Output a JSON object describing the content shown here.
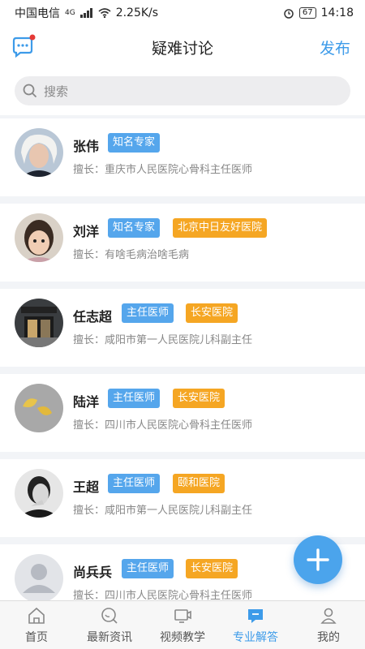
{
  "status": {
    "carrier": "中国电信",
    "net": "4G",
    "speed": "2.25K/s",
    "battery": "67",
    "time": "14:18"
  },
  "header": {
    "title": "疑难讨论",
    "publish": "发布"
  },
  "search": {
    "placeholder": "搜索"
  },
  "experts": [
    {
      "name": "张伟",
      "tags": [
        {
          "text": "知名专家",
          "color": "blue"
        }
      ],
      "specialty": "擅长：重庆市人民医院心骨科主任医师"
    },
    {
      "name": "刘洋",
      "tags": [
        {
          "text": "知名专家",
          "color": "blue"
        },
        {
          "text": "北京中日友好医院",
          "color": "orange"
        }
      ],
      "specialty": "擅长：有啥毛病治啥毛病"
    },
    {
      "name": "任志超",
      "tags": [
        {
          "text": "主任医师",
          "color": "blue"
        },
        {
          "text": "长安医院",
          "color": "orange"
        }
      ],
      "specialty": "擅长：咸阳市第一人民医院儿科副主任"
    },
    {
      "name": "陆洋",
      "tags": [
        {
          "text": "主任医师",
          "color": "blue"
        },
        {
          "text": "长安医院",
          "color": "orange"
        }
      ],
      "specialty": "擅长：四川市人民医院心骨科主任医师"
    },
    {
      "name": "王超",
      "tags": [
        {
          "text": "主任医师",
          "color": "blue"
        },
        {
          "text": "颐和医院",
          "color": "orange"
        }
      ],
      "specialty": "擅长：咸阳市第一人民医院儿科副主任"
    },
    {
      "name": "尚兵兵",
      "tags": [
        {
          "text": "主任医师",
          "color": "blue"
        },
        {
          "text": "长安医院",
          "color": "orange"
        }
      ],
      "specialty": "擅长：四川市人民医院心骨科主任医师"
    }
  ],
  "tabs": [
    {
      "label": "首页",
      "icon": "home-icon"
    },
    {
      "label": "最新资讯",
      "icon": "news-icon"
    },
    {
      "label": "视频教学",
      "icon": "video-icon"
    },
    {
      "label": "专业解答",
      "icon": "answer-icon",
      "active": true
    },
    {
      "label": "我的",
      "icon": "profile-icon"
    }
  ],
  "colors": {
    "accent": "#3d9be9",
    "tag_blue": "#55a6ec",
    "tag_orange": "#f5a623"
  }
}
